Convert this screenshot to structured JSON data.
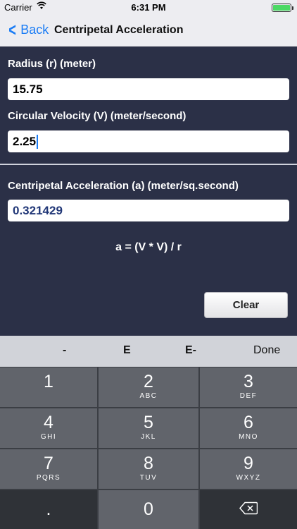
{
  "status": {
    "carrier": "Carrier",
    "time": "6:31 PM"
  },
  "nav": {
    "back_label": "Back",
    "title": "Centripetal Acceleration"
  },
  "form": {
    "radius_label": "Radius (r) (meter)",
    "radius_value": "15.75",
    "velocity_label": "Circular Velocity (V) (meter/second)",
    "velocity_value": "2.25",
    "result_label": "Centripetal Acceleration (a) (meter/sq.second)",
    "result_value": "0.321429",
    "formula": "a = (V * V) / r",
    "clear_label": "Clear"
  },
  "keyboard": {
    "toolbar": [
      "-",
      "E",
      "E-",
      "Done"
    ],
    "keys": [
      {
        "num": "1",
        "letters": ""
      },
      {
        "num": "2",
        "letters": "ABC"
      },
      {
        "num": "3",
        "letters": "DEF"
      },
      {
        "num": "4",
        "letters": "GHI"
      },
      {
        "num": "5",
        "letters": "JKL"
      },
      {
        "num": "6",
        "letters": "MNO"
      },
      {
        "num": "7",
        "letters": "PQRS"
      },
      {
        "num": "8",
        "letters": "TUV"
      },
      {
        "num": "9",
        "letters": "WXYZ"
      },
      {
        "num": ".",
        "letters": ""
      },
      {
        "num": "0",
        "letters": ""
      }
    ],
    "backspace_icon": "backspace-icon"
  }
}
